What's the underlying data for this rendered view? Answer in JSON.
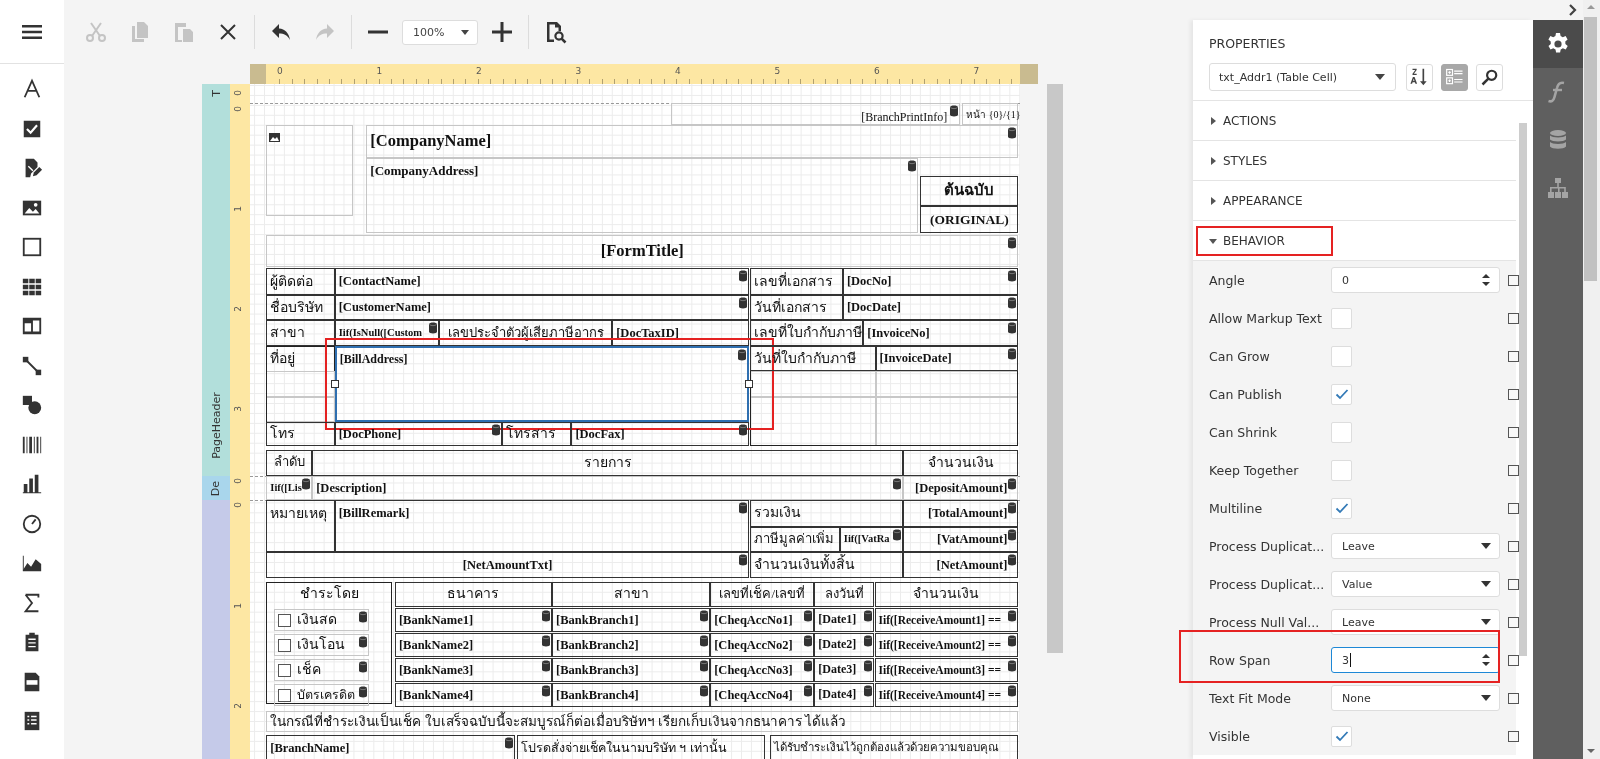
{
  "toolbar": {
    "buttons": [
      {
        "kind": "cut",
        "disabled": true
      },
      {
        "kind": "copy",
        "disabled": true
      },
      {
        "kind": "paste",
        "disabled": true
      },
      {
        "kind": "delete",
        "disabled": false
      },
      {
        "kind": "undo",
        "disabled": false
      },
      {
        "kind": "redo",
        "disabled": true
      },
      {
        "kind": "zoom-out",
        "disabled": false
      },
      {
        "kind": "zoom",
        "value": "100%"
      },
      {
        "kind": "zoom-in",
        "disabled": false
      },
      {
        "kind": "preview",
        "disabled": false
      }
    ]
  },
  "designer": {
    "bands": [
      {
        "label": "T",
        "color": "#b2dfdb"
      },
      {
        "label": "PageHeader",
        "color": "#b2dfdb"
      },
      {
        "label": "De",
        "color": "#a9d6ec"
      },
      {
        "color": "#c5cae9"
      }
    ],
    "horizontal_ruler": [
      "0",
      "1",
      "2",
      "3",
      "4",
      "5",
      "6",
      "7"
    ],
    "vertical_ruler": [
      "0",
      "0",
      "1",
      "2",
      "3",
      "0",
      "0",
      "1",
      "2"
    ],
    "controls": [
      {
        "kind": "plain",
        "text": "[BranchPrintInfo]",
        "bound": true,
        "selected": false,
        "highlighted": false
      },
      {
        "kind": "plain",
        "text": "หน้า {0}/{1}",
        "bound": false,
        "selected": false,
        "highlighted": false
      },
      {
        "kind": "image",
        "bound": false,
        "selected": false,
        "highlighted": false
      },
      {
        "kind": "field",
        "text": "[CompanyName]",
        "bound": true,
        "selected": false,
        "highlighted": false
      },
      {
        "kind": "field",
        "text": "[CompanyAddress]",
        "bound": true,
        "selected": false,
        "highlighted": false
      },
      {
        "kind": "field",
        "text": "ต้นฉบับ",
        "bound": false,
        "selected": false,
        "highlighted": false
      },
      {
        "kind": "field",
        "text": "(ORIGINAL)",
        "bound": false,
        "selected": false,
        "highlighted": false
      },
      {
        "kind": "field",
        "text": "[FormTitle]",
        "bound": true,
        "selected": false,
        "highlighted": false
      },
      {
        "kind": "label",
        "text": "ผู้ติดต่อ",
        "bound": false,
        "selected": false,
        "highlighted": false
      },
      {
        "kind": "field",
        "text": "[ContactName]",
        "bound": true,
        "selected": false,
        "highlighted": false
      },
      {
        "kind": "label",
        "text": "ชื่อบริษัท",
        "bound": false,
        "selected": false,
        "highlighted": false
      },
      {
        "kind": "field",
        "text": "[CustomerName]",
        "bound": true,
        "selected": false,
        "highlighted": false
      },
      {
        "kind": "label",
        "text": "สาขา",
        "bound": false,
        "selected": false,
        "highlighted": false
      },
      {
        "kind": "field",
        "text": "Iif(IsNull([Custom",
        "bound": true,
        "selected": false,
        "highlighted": false
      },
      {
        "kind": "label",
        "text": "เลขประจำตัวผู้เสียภาษีอากร",
        "bound": false,
        "selected": false,
        "highlighted": false
      },
      {
        "kind": "field",
        "text": "[DocTaxID]",
        "bound": false,
        "selected": false,
        "highlighted": false
      },
      {
        "kind": "label",
        "text": "ที่อยู่",
        "bound": false,
        "selected": false,
        "highlighted": false
      },
      {
        "kind": "field",
        "text": "[BillAddress]",
        "bound": true,
        "selected": true,
        "highlighted": true
      },
      {
        "kind": "label",
        "text": "โทร",
        "bound": false,
        "selected": false,
        "highlighted": false
      },
      {
        "kind": "field",
        "text": "[DocPhone]",
        "bound": true,
        "selected": false,
        "highlighted": false
      },
      {
        "kind": "label",
        "text": "โทรสาร",
        "bound": false,
        "selected": false,
        "highlighted": false
      },
      {
        "kind": "field",
        "text": "[DocFax]",
        "bound": true,
        "selected": false,
        "highlighted": false
      },
      {
        "kind": "label",
        "text": "เลขที่เอกสาร",
        "bound": false,
        "selected": false,
        "highlighted": false
      },
      {
        "kind": "field",
        "text": "[DocNo]",
        "bound": true,
        "selected": false,
        "highlighted": false
      },
      {
        "kind": "label",
        "text": "วันที่เอกสาร",
        "bound": false,
        "selected": false,
        "highlighted": false
      },
      {
        "kind": "field",
        "text": "[DocDate]",
        "bound": true,
        "selected": false,
        "highlighted": false
      },
      {
        "kind": "label",
        "text": "เลขที่ใบกำกับภาษี",
        "bound": false,
        "selected": false,
        "highlighted": false
      },
      {
        "kind": "field",
        "text": "[InvoiceNo]",
        "bound": true,
        "selected": false,
        "highlighted": false
      },
      {
        "kind": "label",
        "text": "วันที่ใบกำกับภาษี",
        "bound": false,
        "selected": false,
        "highlighted": false
      },
      {
        "kind": "field",
        "text": "[InvoiceDate]",
        "bound": true,
        "selected": false,
        "highlighted": false
      },
      {
        "kind": "label",
        "text": "ลำดับ",
        "bound": false,
        "selected": false,
        "highlighted": false
      },
      {
        "kind": "label",
        "text": "รายการ",
        "bound": false,
        "selected": false,
        "highlighted": false
      },
      {
        "kind": "label",
        "text": "จำนวนเงิน",
        "bound": false,
        "selected": false,
        "highlighted": false
      },
      {
        "kind": "field",
        "text": "Iif([Lis",
        "bound": true,
        "selected": false,
        "highlighted": false
      },
      {
        "kind": "field",
        "text": "[Description]",
        "bound": true,
        "selected": false,
        "highlighted": false
      },
      {
        "kind": "field",
        "text": "[DepositAmount]",
        "bound": true,
        "selected": false,
        "highlighted": false
      },
      {
        "kind": "label",
        "text": "หมายเหตุ",
        "bound": false,
        "selected": false,
        "highlighted": false
      },
      {
        "kind": "field",
        "text": "[BillRemark]",
        "bound": true,
        "selected": false,
        "highlighted": false
      },
      {
        "kind": "label",
        "text": "รวมเงิน",
        "bound": false,
        "selected": false,
        "highlighted": false
      },
      {
        "kind": "field",
        "text": "[TotalAmount]",
        "bound": true,
        "selected": false,
        "highlighted": false
      },
      {
        "kind": "label",
        "text": "ภาษีมูลค่าเพิ่ม",
        "bound": false,
        "selected": false,
        "highlighted": false
      },
      {
        "kind": "field",
        "text": "Iif([VatRa",
        "bound": true,
        "selected": false,
        "highlighted": false
      },
      {
        "kind": "field",
        "text": "[VatAmount]",
        "bound": true,
        "selected": false,
        "highlighted": false
      },
      {
        "kind": "field",
        "text": "[NetAmountTxt]",
        "bound": true,
        "selected": false,
        "highlighted": false
      },
      {
        "kind": "label",
        "text": "จำนวนเงินทั้งสิ้น",
        "bound": false,
        "selected": false,
        "highlighted": false
      },
      {
        "kind": "field",
        "text": "[NetAmount]",
        "bound": true,
        "selected": false,
        "highlighted": false
      },
      {
        "kind": "label",
        "text": "ชำระโดย",
        "bound": false,
        "selected": false,
        "highlighted": false
      },
      {
        "kind": "label",
        "text": "ธนาคาร",
        "bound": false,
        "selected": false,
        "highlighted": false
      },
      {
        "kind": "label",
        "text": "สาขา",
        "bound": false,
        "selected": false,
        "highlighted": false
      },
      {
        "kind": "label",
        "text": "เลขที่เช็ค/เลขที่",
        "bound": false,
        "selected": false,
        "highlighted": false
      },
      {
        "kind": "label",
        "text": "ลงวันที่",
        "bound": false,
        "selected": false,
        "highlighted": false
      },
      {
        "kind": "label",
        "text": "จำนวนเงิน",
        "bound": false,
        "selected": false,
        "highlighted": false
      },
      {
        "kind": "checkbox",
        "text": "เงินสด",
        "checked": false,
        "bound": true,
        "selected": false,
        "highlighted": false
      },
      {
        "kind": "field",
        "text": "[BankName1]",
        "bound": true,
        "selected": false,
        "highlighted": false
      },
      {
        "kind": "field",
        "text": "[BankBranch1]",
        "bound": true,
        "selected": false,
        "highlighted": false
      },
      {
        "kind": "field",
        "text": "[CheqAccNo1]",
        "bound": true,
        "selected": false,
        "highlighted": false
      },
      {
        "kind": "field",
        "text": "[Date1]",
        "bound": true,
        "selected": false,
        "highlighted": false
      },
      {
        "kind": "field",
        "text": "Iif([ReceiveAmount1] ==",
        "bound": true,
        "selected": false,
        "highlighted": false
      },
      {
        "kind": "checkbox",
        "text": "เงินโอน",
        "checked": false,
        "bound": true,
        "selected": false,
        "highlighted": false
      },
      {
        "kind": "field",
        "text": "[BankName2]",
        "bound": true,
        "selected": false,
        "highlighted": false
      },
      {
        "kind": "field",
        "text": "[BankBranch2]",
        "bound": true,
        "selected": false,
        "highlighted": false
      },
      {
        "kind": "field",
        "text": "[CheqAccNo2]",
        "bound": true,
        "selected": false,
        "highlighted": false
      },
      {
        "kind": "field",
        "text": "[Date2]",
        "bound": true,
        "selected": false,
        "highlighted": false
      },
      {
        "kind": "field",
        "text": "Iif([ReceiveAmount2] ==",
        "bound": true,
        "selected": false,
        "highlighted": false
      },
      {
        "kind": "checkbox",
        "text": "เช็ค",
        "checked": false,
        "bound": true,
        "selected": false,
        "highlighted": false
      },
      {
        "kind": "field",
        "text": "[BankName3]",
        "bound": true,
        "selected": false,
        "highlighted": false
      },
      {
        "kind": "field",
        "text": "[BankBranch3]",
        "bound": true,
        "selected": false,
        "highlighted": false
      },
      {
        "kind": "field",
        "text": "[CheqAccNo3]",
        "bound": true,
        "selected": false,
        "highlighted": false
      },
      {
        "kind": "field",
        "text": "[Date3]",
        "bound": true,
        "selected": false,
        "highlighted": false
      },
      {
        "kind": "field",
        "text": "Iif([ReceiveAmount3] ==",
        "bound": true,
        "selected": false,
        "highlighted": false
      },
      {
        "kind": "checkbox",
        "text": "บัตรเครดิต",
        "checked": false,
        "bound": true,
        "selected": false,
        "highlighted": false
      },
      {
        "kind": "field",
        "text": "[BankName4]",
        "bound": true,
        "selected": false,
        "highlighted": false
      },
      {
        "kind": "field",
        "text": "[BankBranch4]",
        "bound": true,
        "selected": false,
        "highlighted": false
      },
      {
        "kind": "field",
        "text": "[CheqAccNo4]",
        "bound": true,
        "selected": false,
        "highlighted": false
      },
      {
        "kind": "field",
        "text": "[Date4]",
        "bound": true,
        "selected": false,
        "highlighted": false
      },
      {
        "kind": "field",
        "text": "Iif([ReceiveAmount4] ==",
        "bound": true,
        "selected": false,
        "highlighted": false
      },
      {
        "kind": "label",
        "text": "ในกรณีที่ชำระเงินเป็นเช็ค ใบเสร็จฉบับนี้จะสมบูรณ์ก็ต่อเมื่อบริษัทฯ เรียกเก็บเงินจากธนาคาร ได้แล้ว",
        "bound": false,
        "selected": false,
        "highlighted": false
      },
      {
        "kind": "field",
        "text": "[BranchName]",
        "bound": true,
        "selected": false,
        "highlighted": false
      },
      {
        "kind": "label",
        "text": "โปรดสั่งจ่ายเช็คในนามบริษัท ฯ เท่านั้น",
        "bound": false,
        "selected": false,
        "highlighted": false
      },
      {
        "kind": "label",
        "text": "ได้รับชำระเงินไว้ถูกต้องแล้วด้วยความขอบคุณ",
        "bound": false,
        "selected": false,
        "highlighted": false
      }
    ]
  },
  "properties": {
    "title": "PROPERTIES",
    "selector": "txt_Addr1 (Table Cell)",
    "tools": [
      {
        "kind": "sort",
        "selected": false
      },
      {
        "kind": "categories",
        "selected": true
      },
      {
        "kind": "search",
        "selected": false
      }
    ],
    "sections": [
      {
        "label": "ACTIONS",
        "expanded": false,
        "highlighted": false
      },
      {
        "label": "STYLES",
        "expanded": false,
        "highlighted": false
      },
      {
        "label": "APPEARANCE",
        "expanded": false,
        "highlighted": false
      },
      {
        "label": "BEHAVIOR",
        "expanded": true,
        "highlighted": true,
        "rows": [
          {
            "label": "Angle",
            "kind": "number",
            "value": "0",
            "focused": false,
            "highlighted": false,
            "marked": false
          },
          {
            "label": "Allow Markup Text",
            "kind": "checkbox",
            "checked": false,
            "highlighted": false,
            "marked": false
          },
          {
            "label": "Can Grow",
            "kind": "checkbox",
            "checked": false,
            "highlighted": false,
            "marked": false
          },
          {
            "label": "Can Publish",
            "kind": "checkbox",
            "checked": true,
            "highlighted": false,
            "marked": false
          },
          {
            "label": "Can Shrink",
            "kind": "checkbox",
            "checked": false,
            "highlighted": false,
            "marked": false
          },
          {
            "label": "Keep Together",
            "kind": "checkbox",
            "checked": false,
            "highlighted": false,
            "marked": false
          },
          {
            "label": "Multiline",
            "kind": "checkbox",
            "checked": true,
            "highlighted": false,
            "marked": false
          },
          {
            "label": "Process Duplicat...",
            "kind": "select",
            "value": "Leave",
            "highlighted": false,
            "marked": false
          },
          {
            "label": "Process Duplicat...",
            "kind": "select",
            "value": "Value",
            "highlighted": false,
            "marked": false
          },
          {
            "label": "Process Null Val...",
            "kind": "select",
            "value": "Leave",
            "highlighted": false,
            "marked": false
          },
          {
            "label": "Row Span",
            "kind": "number",
            "value": "3",
            "focused": true,
            "highlighted": true,
            "marked": false
          },
          {
            "label": "Text Fit Mode",
            "kind": "select",
            "value": "None",
            "highlighted": false,
            "marked": false
          },
          {
            "label": "Visible",
            "kind": "checkbox",
            "checked": true,
            "highlighted": false,
            "marked": false
          }
        ]
      }
    ]
  },
  "side_tabs": [
    {
      "kind": "properties",
      "selected": true
    },
    {
      "kind": "expressions",
      "selected": false
    },
    {
      "kind": "data",
      "selected": false
    },
    {
      "kind": "outline",
      "selected": false
    }
  ]
}
